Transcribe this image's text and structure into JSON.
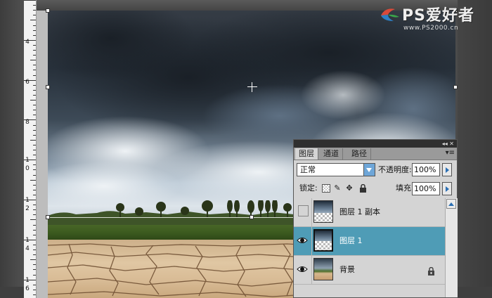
{
  "ruler": {
    "labels": [
      {
        "text": "4"
      },
      {
        "text": "6"
      },
      {
        "text": "8"
      },
      {
        "text": "1"
      },
      {
        "text": "0"
      },
      {
        "text": "1"
      },
      {
        "text": "2"
      },
      {
        "text": "1"
      },
      {
        "text": "4"
      },
      {
        "text": "1"
      },
      {
        "text": "6"
      }
    ]
  },
  "logo": {
    "title": "PS爱好者",
    "url": "www.PS2000.cn"
  },
  "layers_panel": {
    "tabs": [
      "图层",
      "通道",
      "路径"
    ],
    "active_tab": "图层",
    "blend_mode": "正常",
    "opacity_label": "不透明度:",
    "opacity_value": "100%",
    "lock_label": "锁定:",
    "fill_label": "填充:",
    "fill_value": "100%",
    "layers": [
      {
        "name": "图层 1 副本",
        "visible": false,
        "selected": false,
        "thumbnail": "clouds-transparent"
      },
      {
        "name": "图层 1",
        "visible": true,
        "selected": true,
        "thumbnail": "clouds-transparent"
      },
      {
        "name": "背景",
        "visible": true,
        "selected": false,
        "thumbnail": "landscape",
        "locked": true
      }
    ],
    "colors": {
      "selected_row": "#4f9cb6",
      "accent": "#2b6fb3"
    }
  }
}
